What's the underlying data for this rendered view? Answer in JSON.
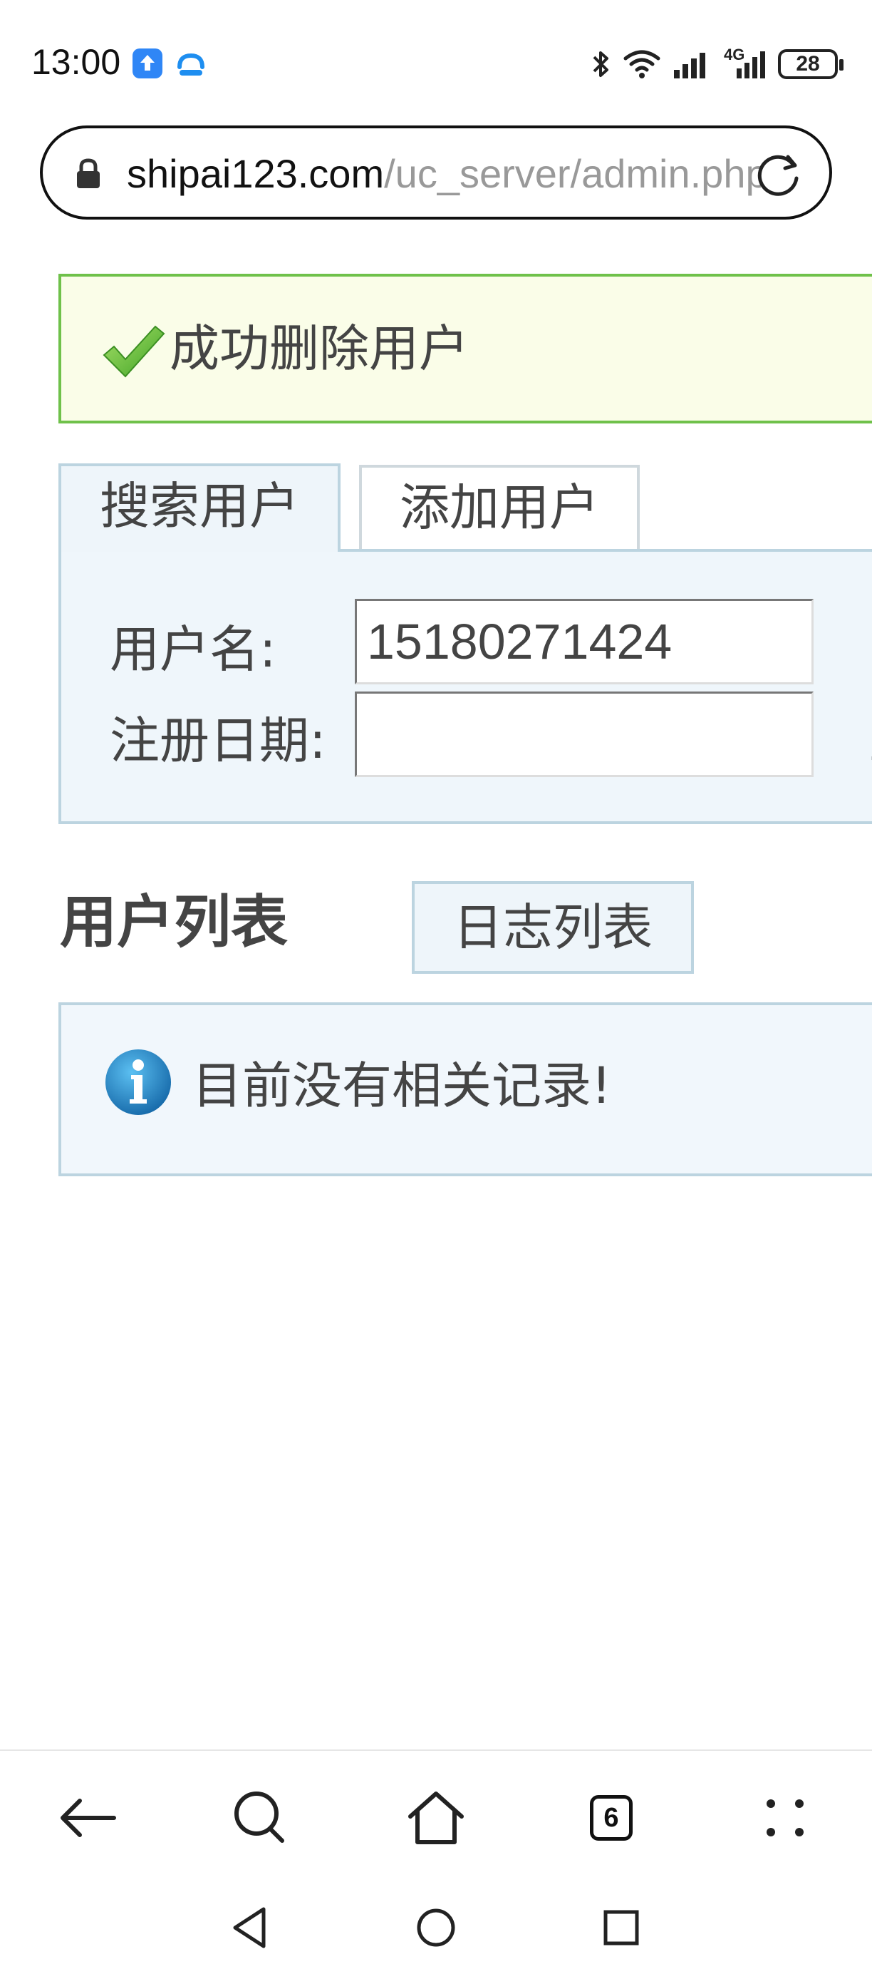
{
  "status_bar": {
    "time": "13:00",
    "network": "4G",
    "battery": "28"
  },
  "address_bar": {
    "host": "shipai123.com",
    "path": "/uc_server/admin.php"
  },
  "message": {
    "text": "成功删除用户"
  },
  "tabs": [
    {
      "label": "搜索用户"
    },
    {
      "label": "添加用户"
    }
  ],
  "search": {
    "username_label": "用户名:",
    "username_value": "15180271424",
    "regdate_label": "注册日期:",
    "regdate_value": ""
  },
  "list": {
    "title": "用户列表",
    "log_button": "日志列表",
    "empty_text": "目前没有相关记录!"
  },
  "toolbar": {
    "tabs_count": "6"
  },
  "icons": {
    "lock": "lock-icon",
    "reload": "reload-icon",
    "check": "check-icon",
    "info": "info-icon",
    "back": "back-arrow-icon",
    "search": "search-icon",
    "home": "home-icon",
    "menu": "menu-dots-icon"
  },
  "colors": {
    "success_border": "#6fc14a",
    "success_bg": "#fafde8",
    "panel_bg": "#eff6fb",
    "panel_border": "#bcd4e0",
    "info_blue": "#1f7fc4"
  }
}
